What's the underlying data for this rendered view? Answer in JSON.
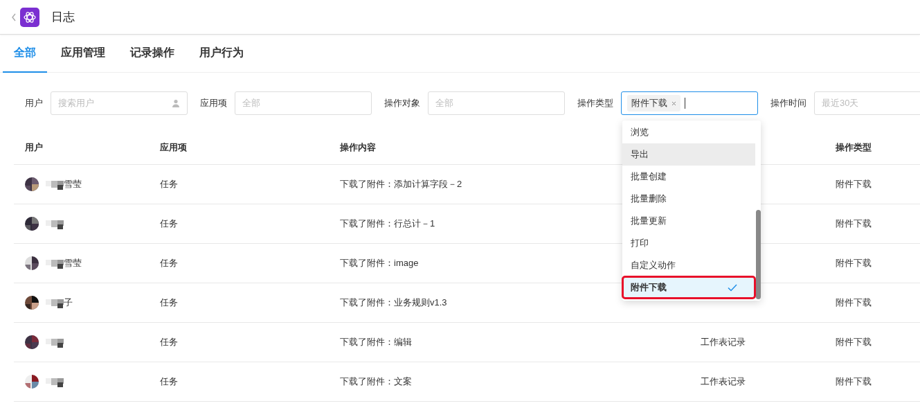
{
  "header": {
    "title": "日志"
  },
  "tabs": [
    {
      "label": "全部",
      "selected": true
    },
    {
      "label": "应用管理",
      "selected": false
    },
    {
      "label": "记录操作",
      "selected": false
    },
    {
      "label": "用户行为",
      "selected": false
    }
  ],
  "filters": [
    {
      "label": "用户",
      "kind": "search",
      "placeholder": "搜索用户"
    },
    {
      "label": "应用项",
      "kind": "select",
      "placeholder": "全部"
    },
    {
      "label": "操作对象",
      "kind": "select",
      "placeholder": "全部"
    },
    {
      "label": "操作类型",
      "kind": "tags",
      "focused": true,
      "tags": [
        "附件下载"
      ]
    },
    {
      "label": "操作时间",
      "kind": "select",
      "placeholder": "最近30天"
    }
  ],
  "dropdown": {
    "options": [
      {
        "label": "浏览",
        "selected": false,
        "hovered": false,
        "outlined": false
      },
      {
        "label": "导出",
        "selected": false,
        "hovered": true,
        "outlined": false
      },
      {
        "label": "批量创建",
        "selected": false,
        "hovered": false,
        "outlined": false
      },
      {
        "label": "批量删除",
        "selected": false,
        "hovered": false,
        "outlined": false
      },
      {
        "label": "批量更新",
        "selected": false,
        "hovered": false,
        "outlined": false
      },
      {
        "label": "打印",
        "selected": false,
        "hovered": false,
        "outlined": false
      },
      {
        "label": "自定义动作",
        "selected": false,
        "hovered": false,
        "outlined": false
      },
      {
        "label": "附件下载",
        "selected": true,
        "hovered": false,
        "outlined": true
      }
    ]
  },
  "table": {
    "columns": [
      "用户",
      "应用项",
      "操作内容",
      "",
      "操作类型"
    ],
    "rows": [
      {
        "user": "雪莹",
        "app": "任务",
        "content": "下载了附件：添加计算字段－2",
        "object": "",
        "type": "附件下载"
      },
      {
        "user": "",
        "app": "任务",
        "content": "下载了附件：行总计－1",
        "object": "",
        "type": "附件下载"
      },
      {
        "user": "雪莹",
        "app": "任务",
        "content": "下载了附件：image",
        "object": "",
        "type": "附件下载"
      },
      {
        "user": "子",
        "app": "任务",
        "content": "下载了附件：业务规则v1.3",
        "object": "",
        "type": "附件下载"
      },
      {
        "user": "",
        "app": "任务",
        "content": "下载了附件：编辑",
        "object": "工作表记录",
        "type": "附件下载"
      },
      {
        "user": "",
        "app": "任务",
        "content": "下载了附件：文案",
        "object": "工作表记录",
        "type": "附件下载"
      }
    ]
  }
}
